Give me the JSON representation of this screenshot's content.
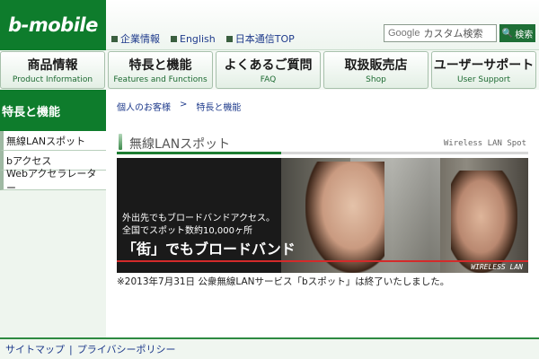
{
  "logo": "b-mobile",
  "toplinks": [
    "企業情報",
    "English",
    "日本通信TOP"
  ],
  "search": {
    "prefix": "Google",
    "placeholder": "カスタム検索",
    "button": "検索"
  },
  "nav": [
    {
      "jp": "商品情報",
      "en": "Product Information"
    },
    {
      "jp": "特長と機能",
      "en": "Features and Functions"
    },
    {
      "jp": "よくあるご質問",
      "en": "FAQ"
    },
    {
      "jp": "取扱販売店",
      "en": "Shop"
    },
    {
      "jp": "ユーザーサポート",
      "en": "User Support"
    }
  ],
  "sidebar": {
    "title": "特長と機能",
    "items": [
      "無線LANスポット",
      "bアクセス",
      "Webアクセラレーター"
    ]
  },
  "breadcrumb": {
    "first": "個人のお客様",
    "sep": ">",
    "second": "特長と機能"
  },
  "section": {
    "title": "無線LANスポット",
    "en": "Wireless LAN Spot"
  },
  "banner": {
    "line1": "外出先でもブロードバンドアクセス。",
    "line2": "全国でスポット数約10,000ヶ所",
    "headline": "「街」でもブロードバンド",
    "badge": "WIRELESS LAN"
  },
  "notice": "※2013年7月31日 公衆無線LANサービス「bスポット」は終了いたしました。",
  "footer": {
    "sitemap": "サイトマップ",
    "sep": "|",
    "privacy": "プライバシーポリシー"
  }
}
